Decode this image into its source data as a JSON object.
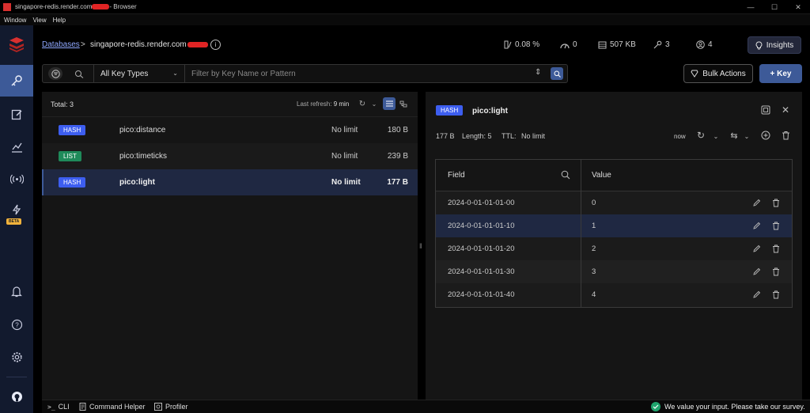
{
  "window": {
    "title_prefix": "singapore-redis.render.com",
    "title_suffix": "- Browser",
    "menu": [
      "Window",
      "View",
      "Help"
    ]
  },
  "header": {
    "breadcrumb_databases": "Databases",
    "breadcrumb_sep": ">",
    "db_host": "singapore-redis.render.com",
    "stats": {
      "cpu": "0.08 %",
      "ops": "0",
      "memory": "507 KB",
      "keys": "3",
      "clients": "4"
    },
    "insights_label": "Insights"
  },
  "filter": {
    "key_type": "All Key Types",
    "placeholder": "Filter by Key Name or Pattern"
  },
  "actions": {
    "bulk_label": "Bulk Actions",
    "add_key_label": "+ Key"
  },
  "key_list": {
    "total": "Total: 3",
    "last_refresh_label": "Last refresh:",
    "last_refresh_value": "9 min",
    "keys": [
      {
        "type": "HASH",
        "name": "pico:distance",
        "ttl": "No limit",
        "size": "180 B",
        "color": "#3d5ef0"
      },
      {
        "type": "LIST",
        "name": "pico:timeticks",
        "ttl": "No limit",
        "size": "239 B",
        "color": "#1f8a5a"
      },
      {
        "type": "HASH",
        "name": "pico:light",
        "ttl": "No limit",
        "size": "177 B",
        "color": "#3d5ef0"
      }
    ]
  },
  "details": {
    "type": "HASH",
    "key": "pico:light",
    "size": "177 B",
    "length": "Length: 5",
    "ttl_label": "TTL:",
    "ttl_value": "No limit",
    "refresh": "now",
    "columns": {
      "field": "Field",
      "value": "Value"
    },
    "rows": [
      {
        "field": "2024-0-01-01-01-00",
        "value": "0"
      },
      {
        "field": "2024-0-01-01-01-10",
        "value": "1"
      },
      {
        "field": "2024-0-01-01-01-20",
        "value": "2"
      },
      {
        "field": "2024-0-01-01-01-30",
        "value": "3"
      },
      {
        "field": "2024-0-01-01-01-40",
        "value": "4"
      }
    ]
  },
  "bottom": {
    "cli": "CLI",
    "command_helper": "Command Helper",
    "profiler": "Profiler",
    "survey": "We value your input. Please take our survey."
  },
  "sidebar": {
    "beta_label": "BETA"
  },
  "colors": {
    "accent": "#3d5a98",
    "hash_badge": "#3d5ef0",
    "list_badge": "#1f8a5a",
    "sidebar_bg": "#121a2e"
  }
}
